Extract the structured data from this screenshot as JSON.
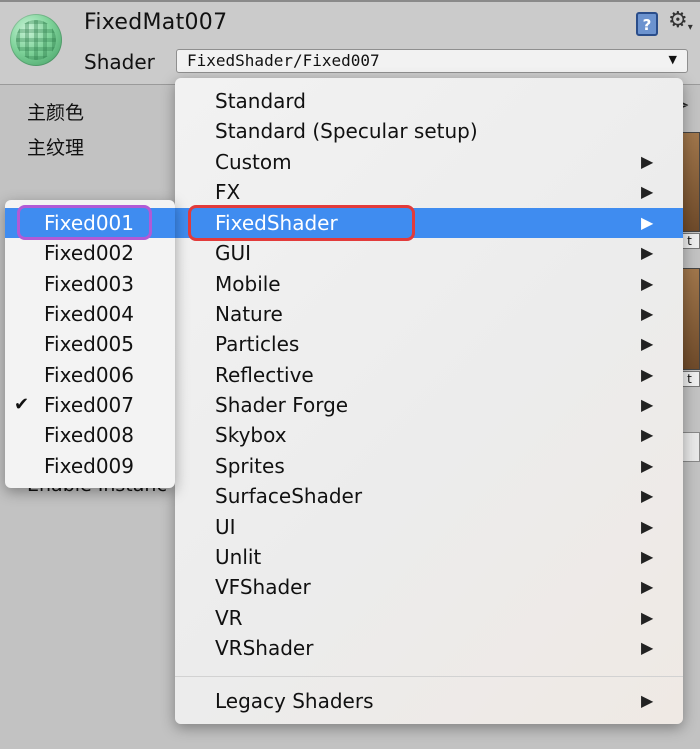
{
  "material": {
    "name": "FixedMat007"
  },
  "shader": {
    "label": "Shader",
    "value": "FixedShader/Fixed007"
  },
  "properties": [
    "主颜色",
    "主纹理"
  ],
  "partial_texts": {
    "hidden_property": "Enable Instanc",
    "thumb_label": "t"
  },
  "icons": {
    "help": "help-book-icon",
    "settings": "gear-icon",
    "dropdown": "chevron-down-icon",
    "submenu_arrow": "triangle-right-icon",
    "check": "checkmark-icon"
  },
  "menu": {
    "items": [
      {
        "label": "Standard",
        "has_submenu": false
      },
      {
        "label": "Standard (Specular setup)",
        "has_submenu": false
      },
      {
        "label": "Custom",
        "has_submenu": true
      },
      {
        "label": "FX",
        "has_submenu": true
      },
      {
        "label": "FixedShader",
        "has_submenu": true,
        "highlighted": true
      },
      {
        "label": "GUI",
        "has_submenu": true
      },
      {
        "label": "Mobile",
        "has_submenu": true
      },
      {
        "label": "Nature",
        "has_submenu": true
      },
      {
        "label": "Particles",
        "has_submenu": true
      },
      {
        "label": "Reflective",
        "has_submenu": true
      },
      {
        "label": "Shader Forge",
        "has_submenu": true
      },
      {
        "label": "Skybox",
        "has_submenu": true
      },
      {
        "label": "Sprites",
        "has_submenu": true
      },
      {
        "label": "SurfaceShader",
        "has_submenu": true
      },
      {
        "label": "UI",
        "has_submenu": true
      },
      {
        "label": "Unlit",
        "has_submenu": true
      },
      {
        "label": "VFShader",
        "has_submenu": true
      },
      {
        "label": "VR",
        "has_submenu": true
      },
      {
        "label": "VRShader",
        "has_submenu": true
      }
    ],
    "footer_item": {
      "label": "Legacy Shaders",
      "has_submenu": true
    }
  },
  "submenu": {
    "items": [
      {
        "label": "Fixed001",
        "highlighted": true
      },
      {
        "label": "Fixed002"
      },
      {
        "label": "Fixed003"
      },
      {
        "label": "Fixed004"
      },
      {
        "label": "Fixed005"
      },
      {
        "label": "Fixed006"
      },
      {
        "label": "Fixed007",
        "checked": true
      },
      {
        "label": "Fixed008"
      },
      {
        "label": "Fixed009"
      }
    ]
  },
  "colors": {
    "highlight": "#3f8cf0",
    "annotation_red": "#e23b3b",
    "annotation_purple": "#b15ad6"
  }
}
